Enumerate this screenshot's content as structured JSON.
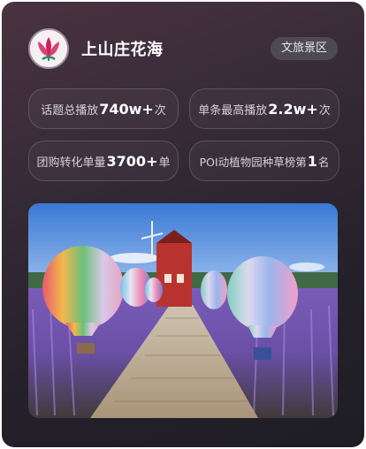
{
  "header": {
    "title": "上山庄花海",
    "tag": "文旅景区",
    "avatar_icon": "lotus-logo-icon"
  },
  "stats": [
    {
      "prefix": "话题总播放",
      "value": "740w+",
      "suffix": "次"
    },
    {
      "prefix": "单条最高播放",
      "value": "2.2w+",
      "suffix": "次"
    },
    {
      "prefix": "团购转化单量",
      "value": "3700+",
      "suffix": "单"
    },
    {
      "prefix": "POI动植物园种草榜第",
      "value": "1",
      "suffix": "名"
    }
  ],
  "colors": {
    "card_top": "#4a3340",
    "card_bottom": "#1f1d24",
    "tag_bg": "#4e4a55",
    "lavender": "#8a68c8",
    "sky": "#3f7fd8"
  }
}
